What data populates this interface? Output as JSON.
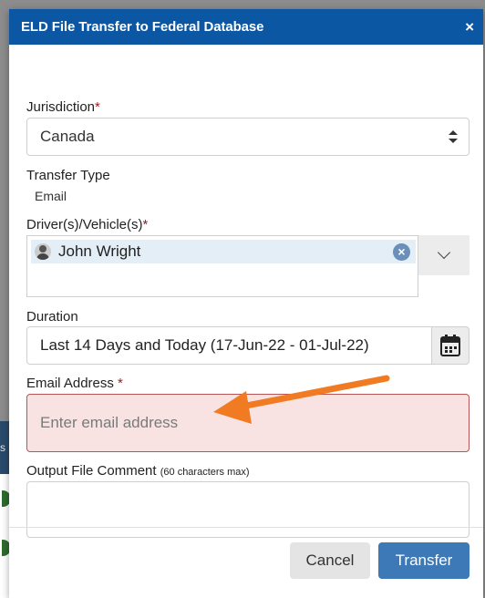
{
  "background": {
    "strip_text": "s"
  },
  "modal": {
    "title": "ELD File Transfer to Federal Database",
    "close_glyph": "×"
  },
  "jurisdiction": {
    "label": "Jurisdiction",
    "required_mark": "*",
    "value": "Canada"
  },
  "transfer_type": {
    "label": "Transfer Type",
    "value": "Email"
  },
  "drivers": {
    "label": "Driver(s)/Vehicle(s)",
    "required_mark": "*",
    "selected": [
      {
        "label": "John Wright",
        "icon": "driver-avatar-icon"
      }
    ],
    "remove_glyph": "×"
  },
  "duration": {
    "label": "Duration",
    "value": "Last 14 Days and Today (17-Jun-22 - 01-Jul-22)"
  },
  "email": {
    "label": "Email Address",
    "required_mark": "*",
    "placeholder": "Enter email address",
    "value": ""
  },
  "comment": {
    "label": "Output File Comment",
    "hint": "(60 characters max)",
    "value": ""
  },
  "buttons": {
    "cancel": "Cancel",
    "transfer": "Transfer"
  },
  "colors": {
    "header": "#0b57a4",
    "primary_button": "#3d78b7",
    "error_bg": "#f9e2e2",
    "error_border": "#b45757",
    "required": "#a01c1c",
    "annotation_arrow": "#f07b22"
  }
}
